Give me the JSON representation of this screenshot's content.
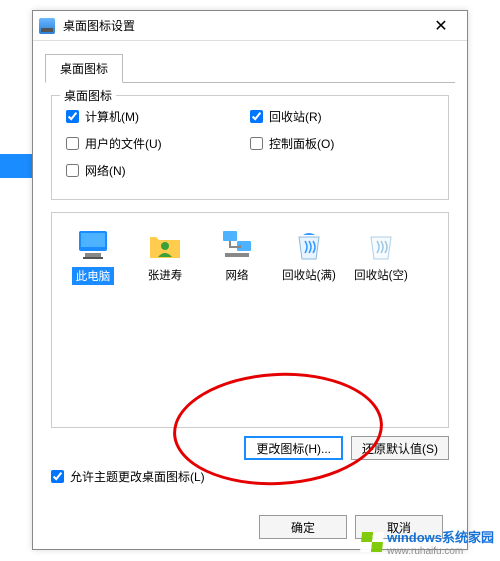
{
  "titlebar": {
    "title": "桌面图标设置",
    "close": "✕"
  },
  "tab": {
    "label": "桌面图标"
  },
  "group": {
    "legend": "桌面图标",
    "checks": {
      "computer": {
        "label": "计算机(M)",
        "checked": true
      },
      "recycle": {
        "label": "回收站(R)",
        "checked": true
      },
      "userfiles": {
        "label": "用户的文件(U)",
        "checked": false
      },
      "ctrlpanel": {
        "label": "控制面板(O)",
        "checked": false
      },
      "network": {
        "label": "网络(N)",
        "checked": false
      }
    }
  },
  "icons": [
    {
      "key": "this-pc",
      "label": "此电脑",
      "selected": true
    },
    {
      "key": "user",
      "label": "张进寿",
      "selected": false
    },
    {
      "key": "network",
      "label": "网络",
      "selected": false
    },
    {
      "key": "recycle-full",
      "label": "回收站(满)",
      "selected": false
    },
    {
      "key": "recycle-empty",
      "label": "回收站(空)",
      "selected": false
    }
  ],
  "buttons": {
    "change_icon": "更改图标(H)...",
    "restore_default": "还原默认值(S)"
  },
  "allow_theme": {
    "label": "允许主题更改桌面图标(L)",
    "checked": true
  },
  "footer": {
    "ok": "确定",
    "cancel": "取消"
  },
  "watermark": {
    "brand": "windows系统家园",
    "url": "www.ruhaifu.com"
  }
}
